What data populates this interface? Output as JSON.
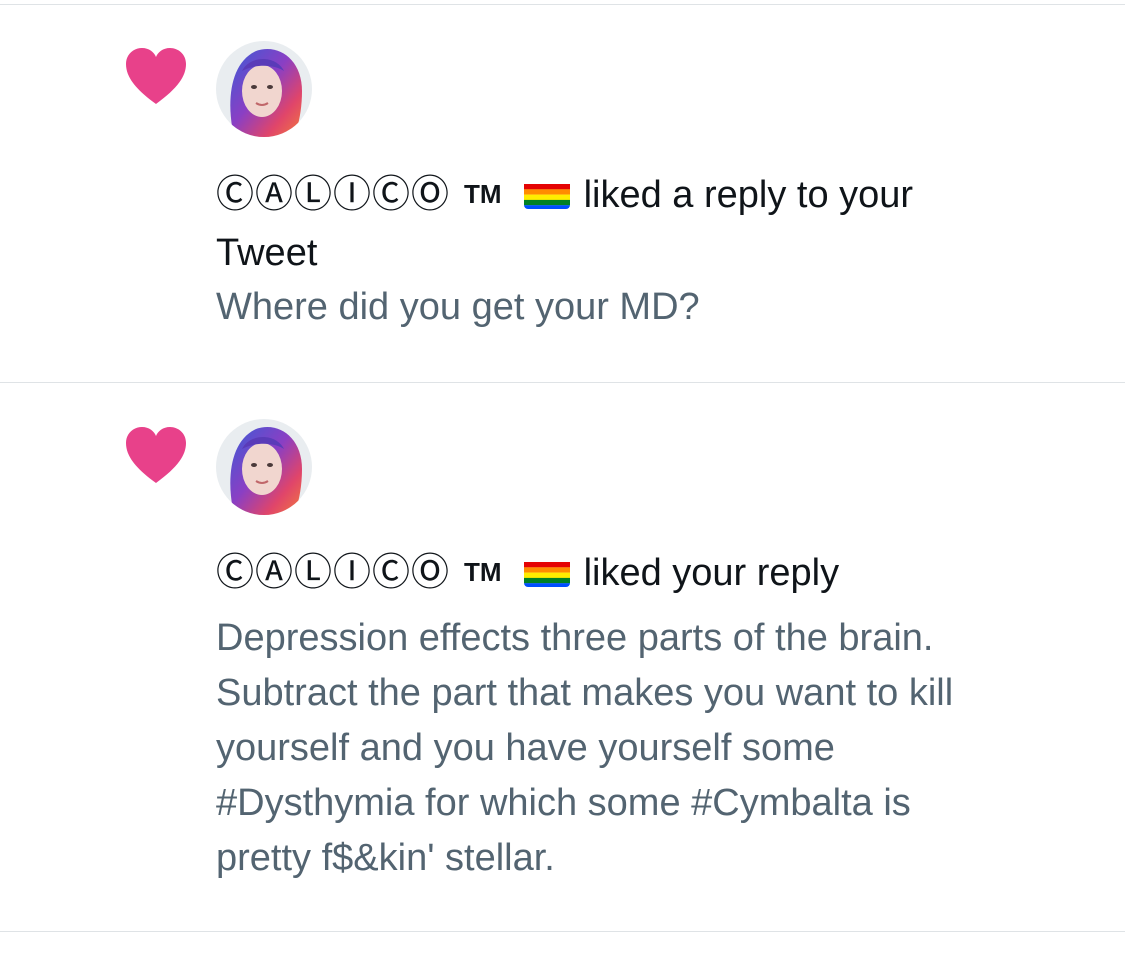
{
  "notifications": [
    {
      "user_name": "ⒸⒶⓁⒾⒸⓄ",
      "tm": "TM",
      "flag_icon": "rainbow-flag-icon",
      "action_line1": "liked a reply to your",
      "action_line2": "Tweet",
      "content": "Where did you get your MD?"
    },
    {
      "user_name": "ⒸⒶⓁⒾⒸⓄ",
      "tm": "TM",
      "flag_icon": "rainbow-flag-icon",
      "action_line1": "liked your reply",
      "content_lines": [
        "Depression effects three parts of the brain.",
        "Subtract the part that makes you want to kill",
        "yourself and you have yourself some",
        "#Dysthymia for which some #Cymbalta is",
        "pretty f$&kin' stellar."
      ]
    }
  ],
  "colors": {
    "heart": "#f91880",
    "secondary_text": "#536471",
    "primary_text": "#0f1419",
    "divider": "#dfe3e6"
  }
}
